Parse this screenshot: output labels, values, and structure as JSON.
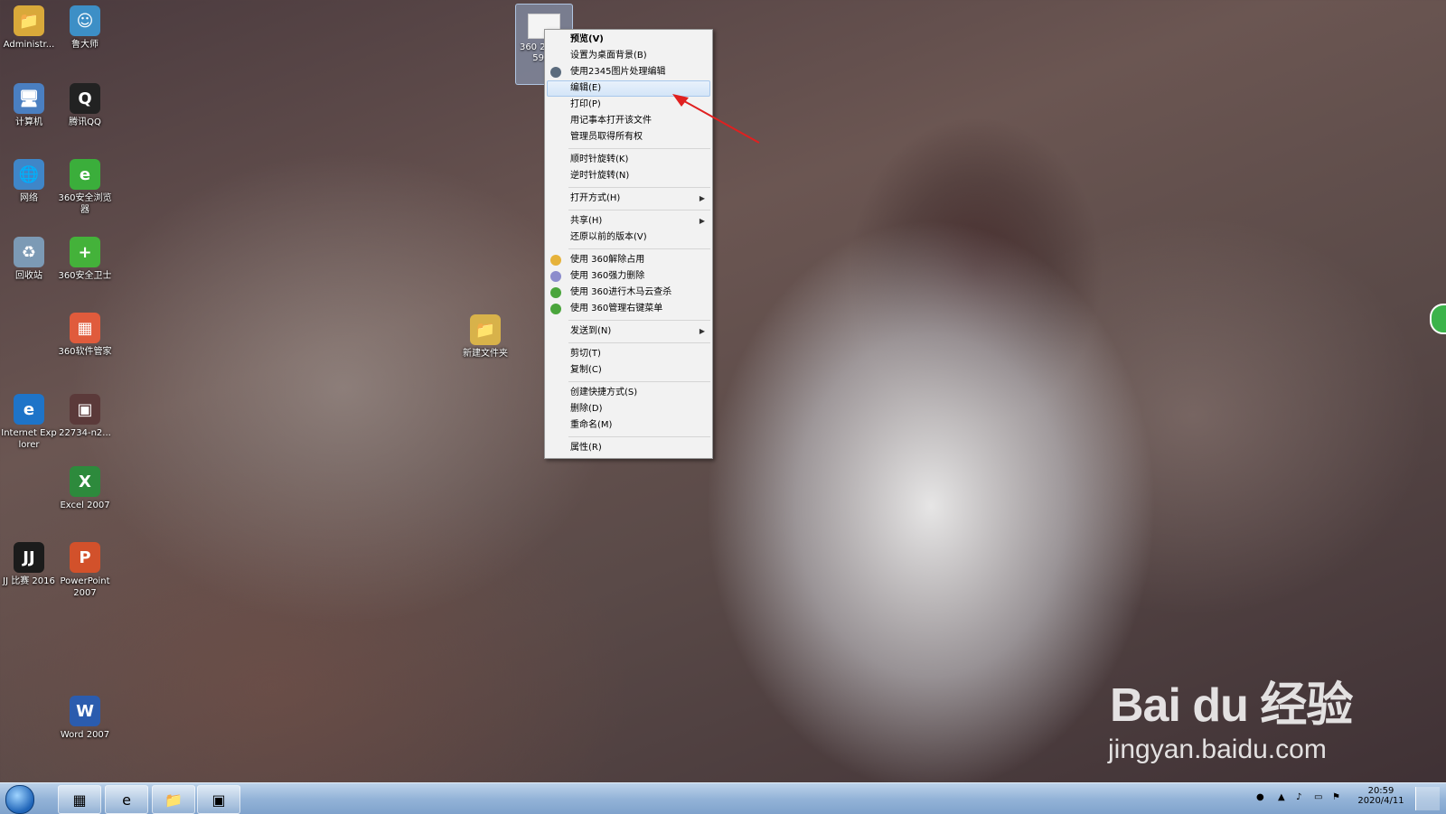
{
  "desktop": {
    "icons": [
      {
        "label": "Administr...",
        "glyph": "📁",
        "color": "#d9a93a"
      },
      {
        "label": "鲁大师",
        "glyph": "☺",
        "color": "#3d8fc6"
      },
      {
        "label": "计算机",
        "glyph": "🖥",
        "color": "#4a7fc1"
      },
      {
        "label": "腾讯QQ",
        "glyph": "Q",
        "color": "#222222"
      },
      {
        "label": "网络",
        "glyph": "🌐",
        "color": "#3f86c8"
      },
      {
        "label": "360安全浏览器",
        "glyph": "e",
        "color": "#3bae3b"
      },
      {
        "label": "回收站",
        "glyph": "♻",
        "color": "#7c9ab5"
      },
      {
        "label": "360安全卫士",
        "glyph": "+",
        "color": "#44b23a"
      },
      {
        "label": "360软件管家",
        "glyph": "▦",
        "color": "#e05b3c"
      },
      {
        "label": "Internet Explorer",
        "glyph": "e",
        "color": "#1e74c8"
      },
      {
        "label": "22734-n2...",
        "glyph": "▣",
        "color": "#5b3a3a"
      },
      {
        "label": "Excel 2007",
        "glyph": "X",
        "color": "#2d8a3c"
      },
      {
        "label": "JJ 比赛 2016",
        "glyph": "JJ",
        "color": "#1b1b1b"
      },
      {
        "label": "PowerPoint 2007",
        "glyph": "P",
        "color": "#d2512b"
      },
      {
        "label": "Word 2007",
        "glyph": "W",
        "color": "#2b5cae"
      }
    ],
    "selected_file_label": "360 20200 5902",
    "new_folder_label": "新建文件夹"
  },
  "context_menu": {
    "items": [
      {
        "label": "预览(V)",
        "bold": true
      },
      {
        "label": "设置为桌面背景(B)"
      },
      {
        "label": "使用2345图片处理编辑",
        "icon": "#5b6b7d"
      },
      {
        "label": "编辑(E)",
        "highlight": true
      },
      {
        "label": "打印(P)"
      },
      {
        "label": "用记事本打开该文件"
      },
      {
        "label": "管理员取得所有权"
      },
      {
        "sep": true
      },
      {
        "label": "顺时针旋转(K)"
      },
      {
        "label": "逆时针旋转(N)"
      },
      {
        "sep": true
      },
      {
        "label": "打开方式(H)",
        "submenu": true
      },
      {
        "sep": true
      },
      {
        "label": "共享(H)",
        "submenu": true
      },
      {
        "label": "还原以前的版本(V)"
      },
      {
        "sep": true
      },
      {
        "label": "使用 360解除占用",
        "icon": "#e6b23a"
      },
      {
        "label": "使用 360强力删除",
        "icon": "#8c8ccc"
      },
      {
        "label": "使用 360进行木马云查杀",
        "icon": "#4aa53c"
      },
      {
        "label": "使用 360管理右键菜单",
        "icon": "#4aa53c"
      },
      {
        "sep": true
      },
      {
        "label": "发送到(N)",
        "submenu": true
      },
      {
        "sep": true
      },
      {
        "label": "剪切(T)"
      },
      {
        "label": "复制(C)"
      },
      {
        "sep": true
      },
      {
        "label": "创建快捷方式(S)"
      },
      {
        "label": "删除(D)"
      },
      {
        "label": "重命名(M)"
      },
      {
        "sep": true
      },
      {
        "label": "属性(R)"
      }
    ]
  },
  "taskbar": {
    "time": "20:59",
    "date": "2020/4/11"
  },
  "watermark": {
    "main": "Bai du 经验",
    "sub": "jingyan.baidu.com"
  },
  "colors": {
    "arrow": "#e02020",
    "menu_highlight": "#d4e5f8"
  }
}
